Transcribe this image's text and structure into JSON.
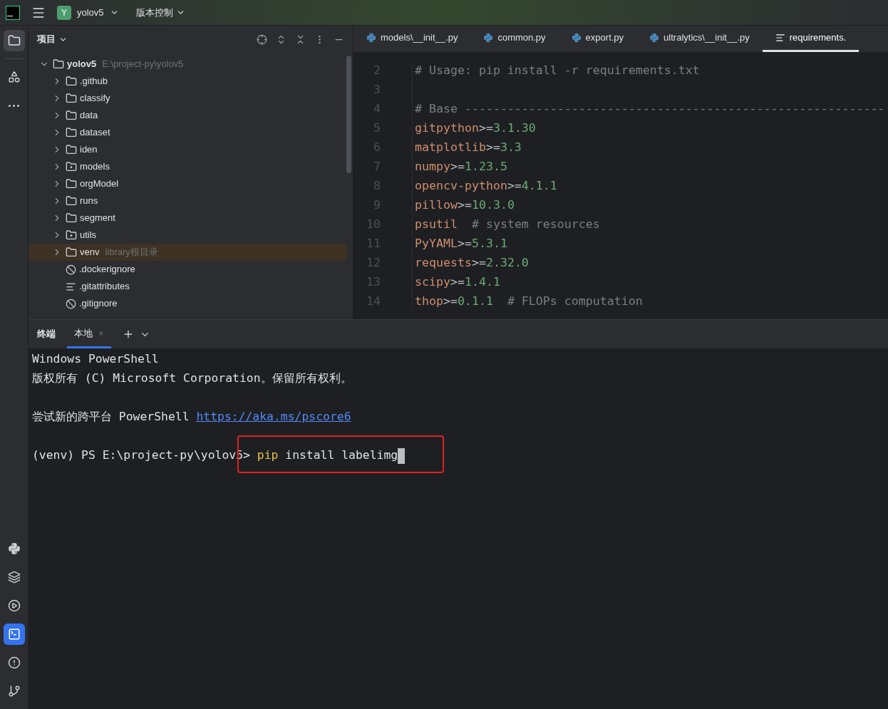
{
  "title_bar": {
    "project_badge": "Y",
    "project": "yolov5",
    "vcs": "版本控制"
  },
  "sidebar_top": [
    {
      "selected": true
    },
    {
      "selected": false
    },
    {
      "selected": false
    }
  ],
  "sidebar_bottom": [
    {
      "selected": false
    },
    {
      "selected": false
    },
    {
      "selected": false
    },
    {
      "selected": true
    },
    {
      "selected": false
    },
    {
      "selected": false
    }
  ],
  "project_panel": {
    "title": "项目",
    "tree": [
      {
        "name": "yolov5",
        "hint": "E:\\project-py\\yolov5",
        "kind": "folder",
        "expanded": true,
        "highlighted": false,
        "children": [
          {
            "name": ".github",
            "kind": "folder",
            "expanded": false,
            "highlighted": false
          },
          {
            "name": "classify",
            "kind": "folder",
            "expanded": false,
            "highlighted": false
          },
          {
            "name": "data",
            "kind": "folder",
            "expanded": false,
            "highlighted": false
          },
          {
            "name": "dataset",
            "kind": "folder",
            "expanded": false,
            "highlighted": false
          },
          {
            "name": "iden",
            "kind": "folder",
            "expanded": false,
            "highlighted": false
          },
          {
            "name": "models",
            "kind": "package",
            "expanded": false,
            "highlighted": false
          },
          {
            "name": "orgModel",
            "kind": "folder",
            "expanded": false,
            "highlighted": false
          },
          {
            "name": "runs",
            "kind": "folder",
            "expanded": false,
            "highlighted": false
          },
          {
            "name": "segment",
            "kind": "folder",
            "expanded": false,
            "highlighted": false
          },
          {
            "name": "utils",
            "kind": "package",
            "expanded": false,
            "highlighted": false
          },
          {
            "name": "venv",
            "hint": "library根目录",
            "kind": "folder",
            "expanded": false,
            "highlighted": true
          },
          {
            "name": ".dockerignore",
            "kind": "ignore",
            "highlighted": false
          },
          {
            "name": ".gitattributes",
            "kind": "text",
            "highlighted": false
          },
          {
            "name": ".gitignore",
            "kind": "ignore",
            "highlighted": false
          }
        ]
      }
    ]
  },
  "editor_tabs": [
    {
      "label": "models\\__init__.py",
      "kind": "python",
      "selected": false
    },
    {
      "label": "common.py",
      "kind": "python",
      "selected": false
    },
    {
      "label": "export.py",
      "kind": "python",
      "selected": false
    },
    {
      "label": "ultralytics\\__init__.py",
      "kind": "python",
      "selected": false
    },
    {
      "label": "requirements.",
      "kind": "text",
      "selected": true
    }
  ],
  "editor_lines": [
    {
      "number": "2",
      "segments": [
        {
          "text": "# Usage: pip install -r requirements.txt",
          "kind": "comment"
        }
      ]
    },
    {
      "number": "3"
    },
    {
      "number": "4",
      "segments": [
        {
          "text": "# Base -----------------------------------------------------------",
          "kind": "comment"
        }
      ]
    },
    {
      "number": "5",
      "segments": [
        {
          "text": "gitpython",
          "kind": "package"
        },
        {
          "text": ">=",
          "kind": "operator"
        },
        {
          "text": "3.1.30",
          "kind": "version"
        }
      ]
    },
    {
      "number": "6",
      "segments": [
        {
          "text": "matplotlib",
          "kind": "package"
        },
        {
          "text": ">=",
          "kind": "operator"
        },
        {
          "text": "3.3",
          "kind": "version"
        }
      ]
    },
    {
      "number": "7",
      "segments": [
        {
          "text": "numpy",
          "kind": "package"
        },
        {
          "text": ">=",
          "kind": "operator"
        },
        {
          "text": "1.23.5",
          "kind": "version"
        }
      ]
    },
    {
      "number": "8",
      "segments": [
        {
          "text": "opencv-python",
          "kind": "package"
        },
        {
          "text": ">=",
          "kind": "operator"
        },
        {
          "text": "4.1.1",
          "kind": "version"
        }
      ]
    },
    {
      "number": "9",
      "segments": [
        {
          "text": "pillow",
          "kind": "package"
        },
        {
          "text": ">=",
          "kind": "operator"
        },
        {
          "text": "10.3.0",
          "kind": "version"
        }
      ]
    },
    {
      "number": "10",
      "segments": [
        {
          "text": "psutil",
          "kind": "package"
        },
        {
          "text": "  # system resources",
          "kind": "comment"
        }
      ]
    },
    {
      "number": "11",
      "segments": [
        {
          "text": "PyYAML",
          "kind": "package"
        },
        {
          "text": ">=",
          "kind": "operator"
        },
        {
          "text": "5.3.1",
          "kind": "version"
        }
      ]
    },
    {
      "number": "12",
      "segments": [
        {
          "text": "requests",
          "kind": "package"
        },
        {
          "text": ">=",
          "kind": "operator"
        },
        {
          "text": "2.32.0",
          "kind": "version"
        }
      ]
    },
    {
      "number": "13",
      "segments": [
        {
          "text": "scipy",
          "kind": "package"
        },
        {
          "text": ">=",
          "kind": "operator"
        },
        {
          "text": "1.4.1",
          "kind": "version"
        }
      ]
    },
    {
      "number": "14",
      "segments": [
        {
          "text": "thop",
          "kind": "package"
        },
        {
          "text": ">=",
          "kind": "operator"
        },
        {
          "text": "0.1.1",
          "kind": "version"
        },
        {
          "text": "  # FLOPs computation",
          "kind": "comment"
        }
      ]
    }
  ],
  "terminal": {
    "title": "终端",
    "tabs": [
      {
        "label": "本地",
        "selected": true,
        "close": "×"
      }
    ],
    "blocks": [
      {
        "lines": [
          {
            "segments": [
              {
                "text": "Windows PowerShell",
                "kind": "plain"
              }
            ]
          },
          {
            "segments": [
              {
                "text": "版权所有 (C) Microsoft Corporation。保留所有权利。",
                "kind": "plain"
              }
            ]
          }
        ]
      },
      {
        "lines": [
          {
            "segments": [
              {
                "text": "尝试新的跨平台 PowerShell ",
                "kind": "plain"
              },
              {
                "text": "https://aka.ms/pscore6",
                "kind": "link"
              }
            ]
          }
        ]
      },
      {
        "lines": [
          {
            "segments": [
              {
                "text": "(venv) PS E:\\project-py\\yolov5> ",
                "kind": "plain"
              },
              {
                "text": "pip",
                "kind": "command"
              },
              {
                "text": " install labelimg",
                "kind": "plain"
              }
            ],
            "cursor": true
          }
        ]
      }
    ]
  }
}
